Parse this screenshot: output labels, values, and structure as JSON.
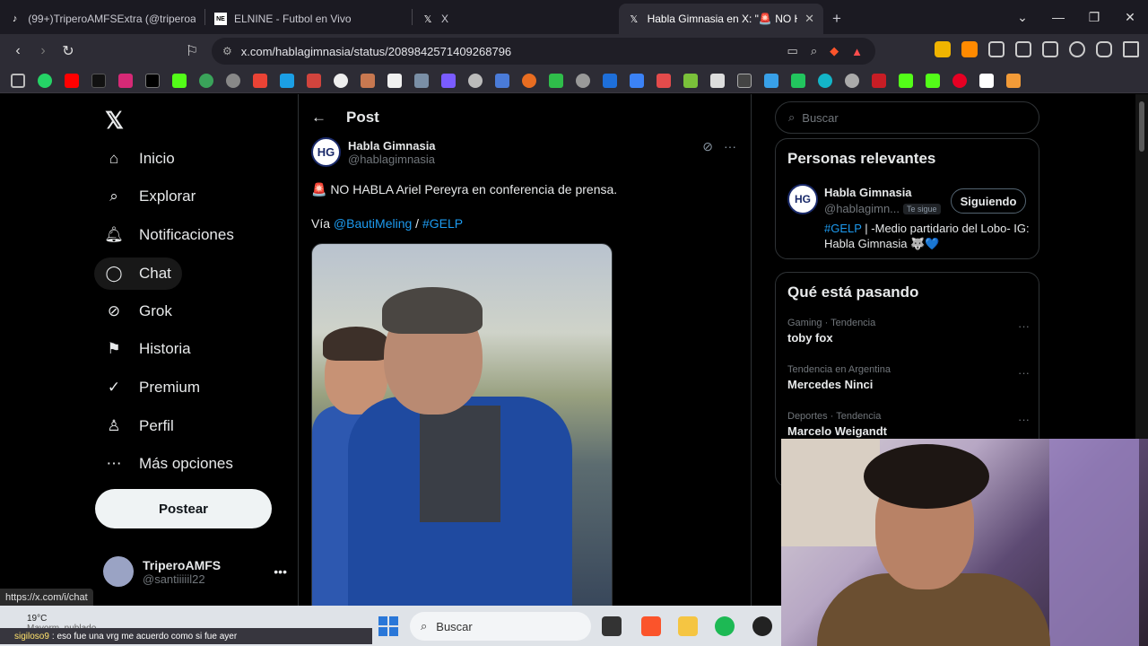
{
  "browser": {
    "tabs": [
      {
        "title": "(99+)TriperoAMFSExtra (@triperoam",
        "icon": "tiktok-icon",
        "active": false
      },
      {
        "title": "ELNINE - Futbol en Vivo",
        "icon": "elnine-icon",
        "active": false
      },
      {
        "title": "X",
        "icon": "x-icon",
        "active": false
      },
      {
        "title": "Habla Gimnasia en X: \"🚨 NO H",
        "icon": "x-icon",
        "active": true
      }
    ],
    "new_tab": "+",
    "url": "x.com/hablagimnasia/status/2089842571409268796",
    "status_url": "https://x.com/i/chat"
  },
  "colors": {
    "accent": "#1d9bf0",
    "background": "#000000",
    "border": "#2f3336"
  },
  "sidebar": {
    "items": [
      {
        "label": "Inicio",
        "icon": "home-icon"
      },
      {
        "label": "Explorar",
        "icon": "search-icon"
      },
      {
        "label": "Notificaciones",
        "icon": "bell-icon"
      },
      {
        "label": "Chat",
        "icon": "chat-bubble-icon"
      },
      {
        "label": "Grok",
        "icon": "grok-icon"
      },
      {
        "label": "Historia",
        "icon": "bookmark-icon"
      },
      {
        "label": "Premium",
        "icon": "verified-icon"
      },
      {
        "label": "Perfil",
        "icon": "person-icon"
      },
      {
        "label": "Más opciones",
        "icon": "more-circle-icon"
      }
    ],
    "post_button": "Postear",
    "account": {
      "name": "TriperoAMFS",
      "handle": "@santiiiiil22"
    }
  },
  "post": {
    "header": "Post",
    "author_name": "Habla Gimnasia",
    "author_handle": "@hablagimnasia",
    "avatar_text": "HG",
    "text_line1": "🚨 NO HABLA Ariel Pereyra en conferencia de prensa.",
    "via_prefix": "Vía ",
    "mention": "@BautiMeling",
    "separator": " / ",
    "hashtag": "#GELP"
  },
  "right": {
    "search_placeholder": "Buscar",
    "relevant": {
      "title": "Personas relevantes",
      "name": "Habla Gimnasia",
      "handle": "@hablagimn...",
      "badge": "Te sigue",
      "follow_label": "Siguiendo",
      "bio_hashtag": "#GELP",
      "bio_text": " | -Medio partidario del Lobo- IG: Habla Gimnasia 🐺💙"
    },
    "trends": {
      "title": "Qué está pasando",
      "items": [
        {
          "context": "Gaming · Tendencia",
          "name": "toby fox"
        },
        {
          "context": "Tendencia en Argentina",
          "name": "Mercedes Ninci"
        },
        {
          "context": "Deportes · Tendencia",
          "name": "Marcelo Weigandt"
        }
      ]
    }
  },
  "taskbar": {
    "weather_temp": "19°C",
    "weather_desc": "Mayorm. nublado",
    "search": "Buscar"
  },
  "chat_overlay": {
    "user": "sigiloso9",
    "message": ": eso fue una vrg me acuerdo como si fue ayer"
  }
}
